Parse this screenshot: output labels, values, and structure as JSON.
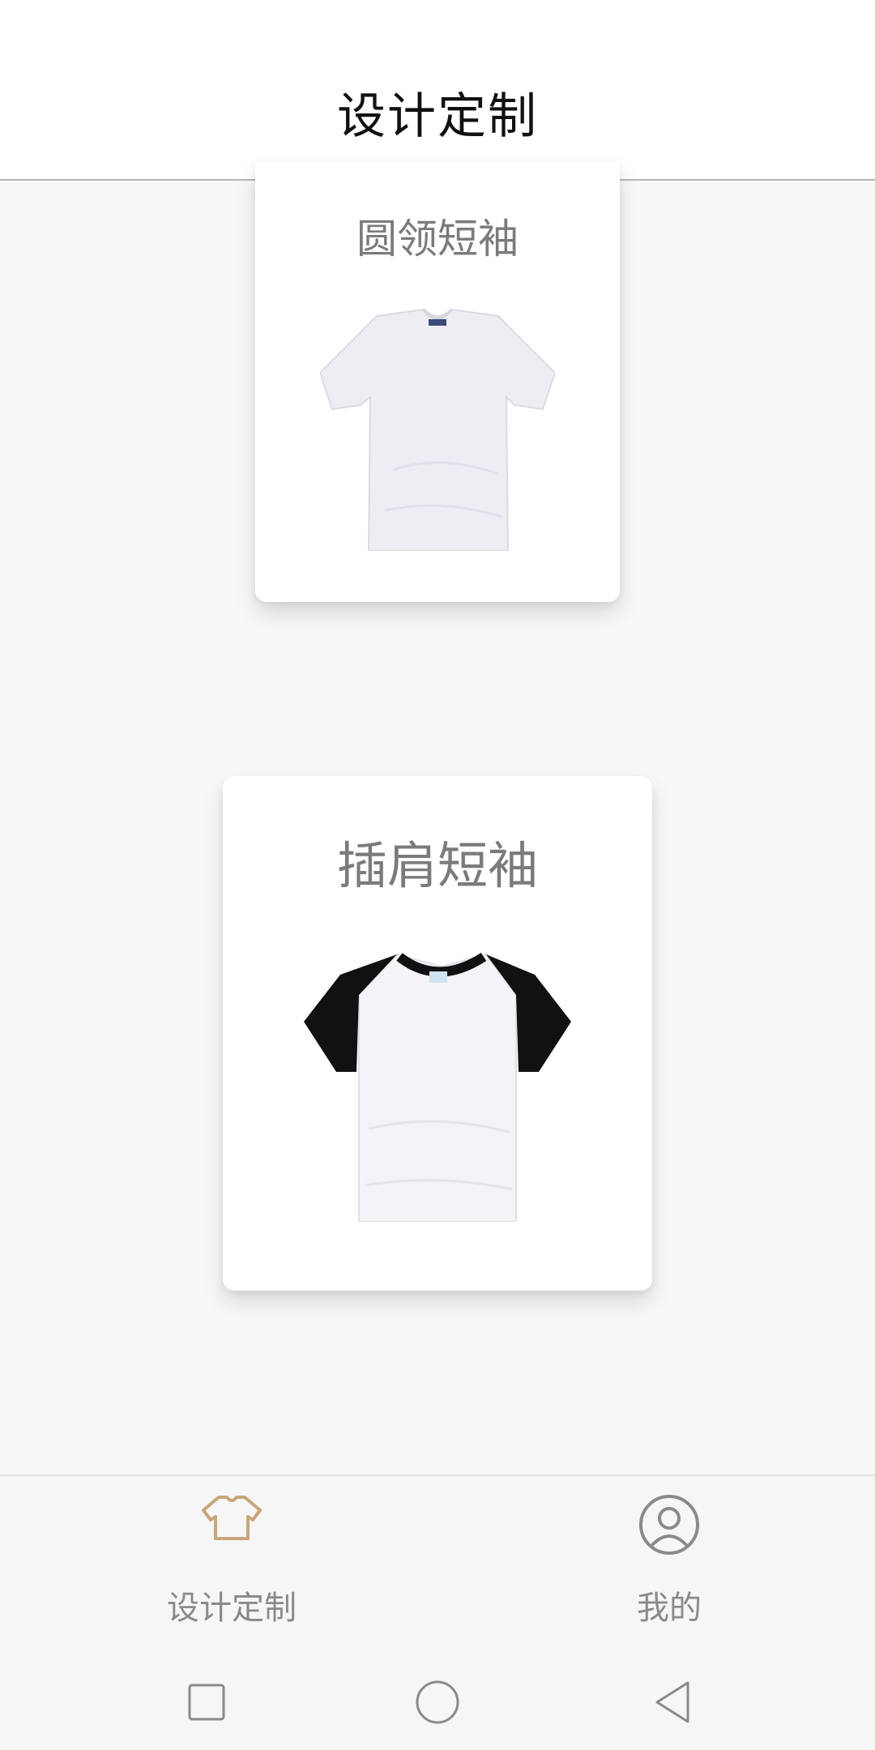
{
  "header": {
    "title": "设计定制"
  },
  "products": [
    {
      "title": "圆领短袖",
      "icon": "crew-neck-tshirt-image"
    },
    {
      "title": "插肩短袖",
      "icon": "raglan-tshirt-image"
    }
  ],
  "tab_bar": {
    "items": [
      {
        "label": "设计定制",
        "icon": "tshirt-icon",
        "active": true,
        "color": "#c9a57a"
      },
      {
        "label": "我的",
        "icon": "user-circle-icon",
        "active": false,
        "color": "#8a8a8a"
      }
    ]
  },
  "system_nav": {
    "items": [
      {
        "icon": "square-recents-icon"
      },
      {
        "icon": "circle-home-icon"
      },
      {
        "icon": "triangle-back-icon"
      }
    ]
  }
}
